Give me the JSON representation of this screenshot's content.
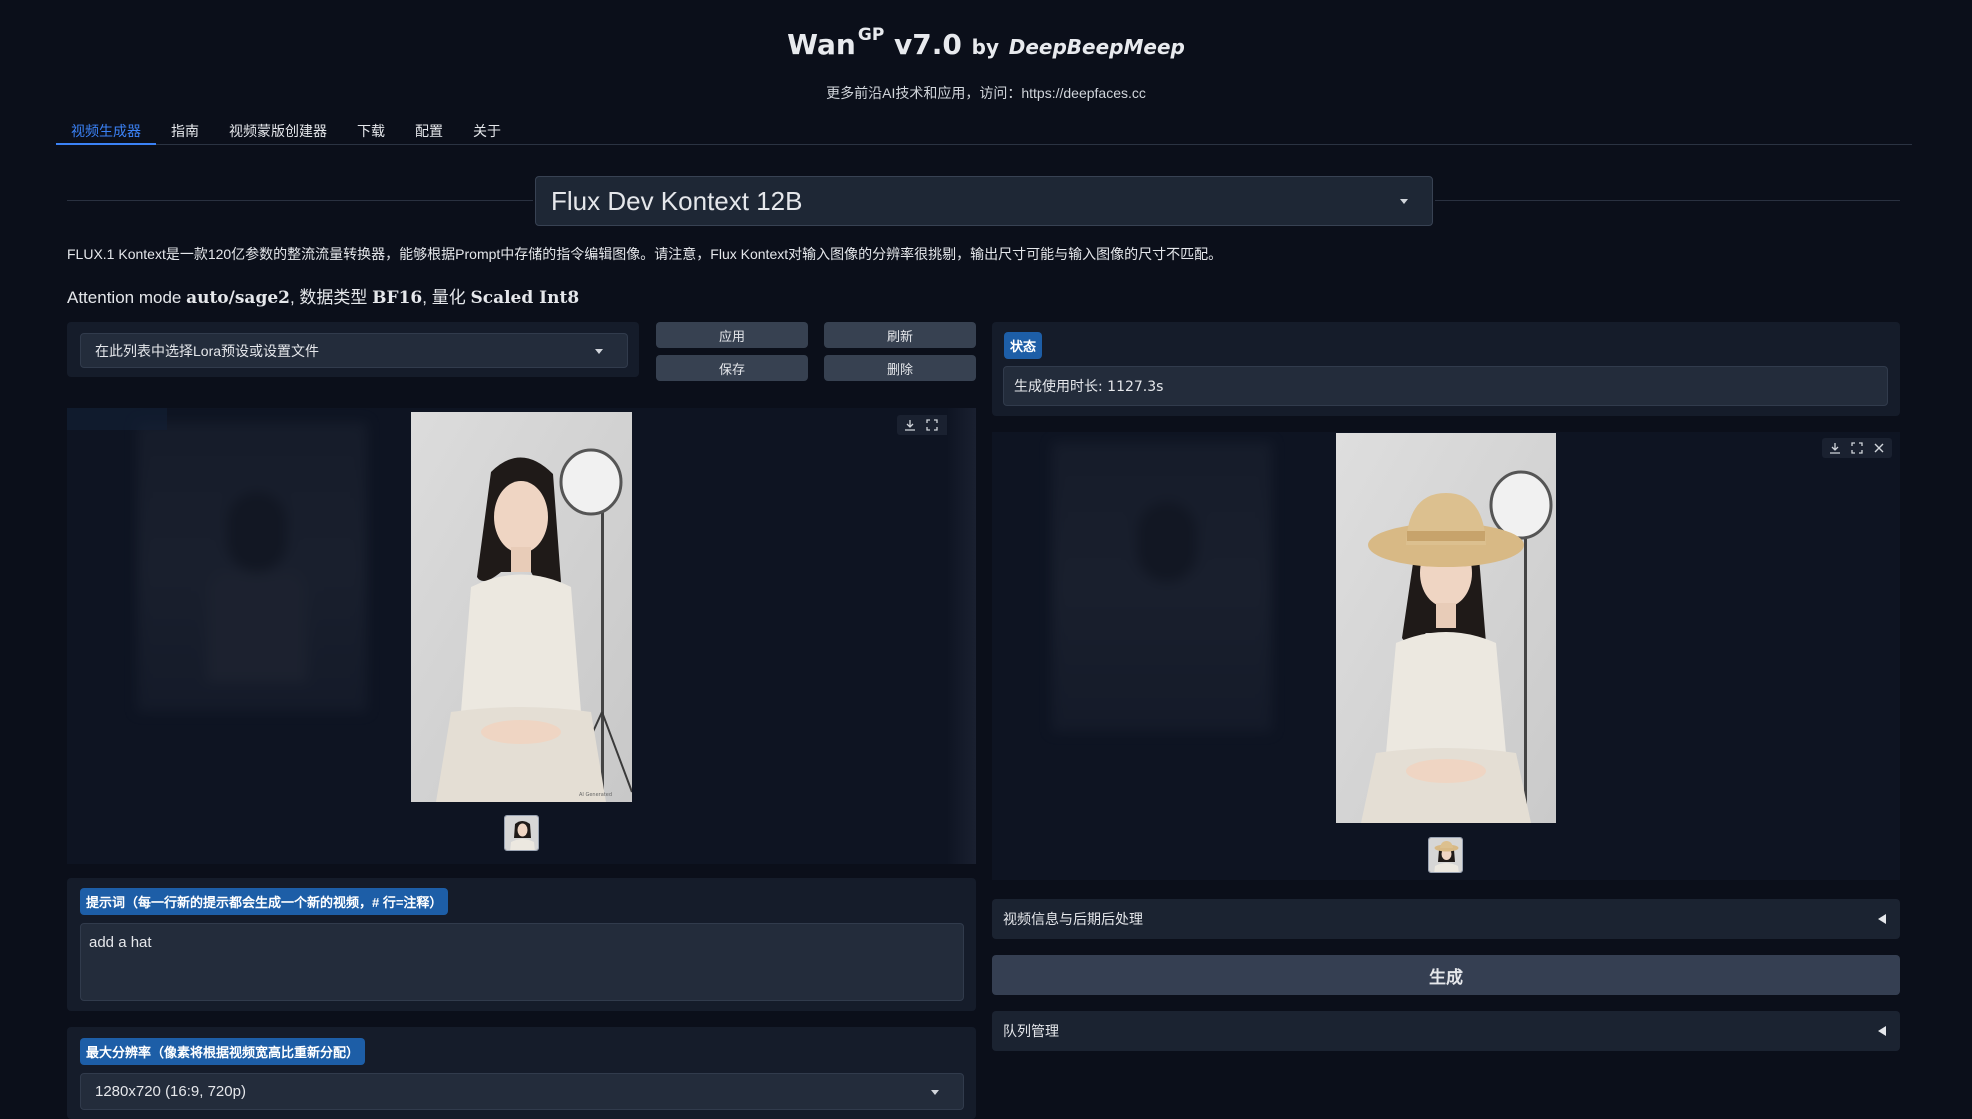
{
  "header": {
    "title_main": "Wan",
    "title_sup": "GP",
    "title_version": "v7.0",
    "title_by": "by",
    "title_author": "DeepBeepMeep",
    "subtitle": "更多前沿AI技术和应用，访问：https://deepfaces.cc"
  },
  "tabs": [
    {
      "label": "视频生成器",
      "active": true
    },
    {
      "label": "指南"
    },
    {
      "label": "视频蒙版创建器"
    },
    {
      "label": "下载"
    },
    {
      "label": "配置"
    },
    {
      "label": "关于"
    }
  ],
  "model": {
    "selected": "Flux Dev Kontext 12B"
  },
  "description": "FLUX.1 Kontext是一款120亿参数的整流流量转换器，能够根据Prompt中存储的指令编辑图像。请注意，Flux Kontext对输入图像的分辨率很挑剔，输出尺寸可能与输入图像的尺寸不匹配。",
  "attention": {
    "prefix": "Attention mode ",
    "mode": "auto/sage2",
    "dtype_label": ", 数据类型 ",
    "dtype": "BF16",
    "quant_label": ", 量化 ",
    "quant": "Scaled Int8"
  },
  "lora": {
    "placeholder": "在此列表中选择Lora预设或设置文件",
    "apply": "应用",
    "refresh": "刷新",
    "save": "保存",
    "delete": "删除"
  },
  "status": {
    "label": "状态",
    "value": "生成使用时长: 1127.3s"
  },
  "prompt": {
    "label": "提示词（每一行新的提示都会生成一个新的视频，# 行=注释）",
    "value": "add a hat"
  },
  "resolution": {
    "label": "最大分辨率（像素将根据视频宽高比重新分配）",
    "value": "1280x720 (16:9, 720p)"
  },
  "video_info_label": "视频信息与后期后处理",
  "generate_label": "生成",
  "queue_label": "队列管理",
  "input_image": {
    "watermark": "AI Generated"
  },
  "icons": [
    "download-icon",
    "fullscreen-icon",
    "close-icon"
  ],
  "colors": {
    "accent": "#3b82f6",
    "badge": "#1d5ea7",
    "background": "#0b0f1a"
  }
}
